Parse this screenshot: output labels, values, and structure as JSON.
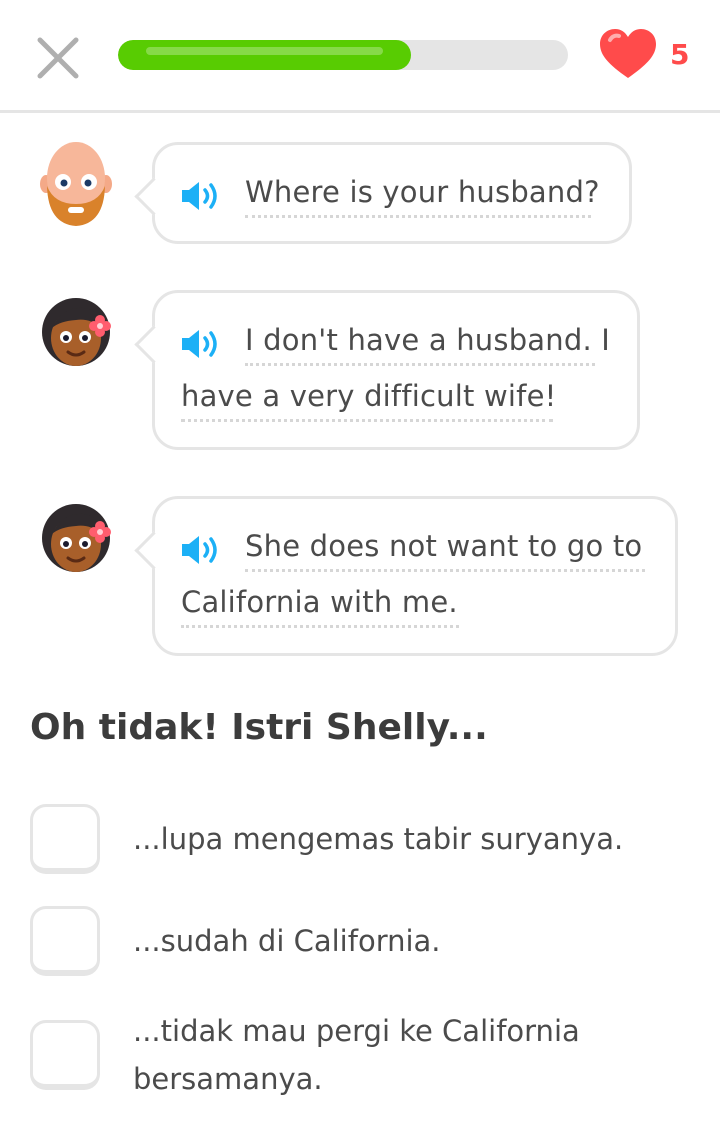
{
  "header": {
    "close_icon": "close-x-icon",
    "progress_percent": 65,
    "progress_color": "#58cc02",
    "hearts_icon": "heart-icon",
    "hearts_count": "5",
    "hearts_color": "#ff4b4b"
  },
  "dialogue": [
    {
      "speaker": "bald-bearded-man-avatar",
      "lines": [
        "Where is your husband?"
      ]
    },
    {
      "speaker": "woman-with-flower-avatar",
      "lines": [
        "I don't have a husband. I",
        "have a very difficult wife!"
      ]
    },
    {
      "speaker": "woman-with-flower-avatar",
      "lines": [
        "She does not want to go to",
        "California with me."
      ]
    }
  ],
  "question": "Oh tidak! Istri Shelly...",
  "options": [
    {
      "lines": [
        "...lupa mengemas tabir suryanya."
      ],
      "checked": false
    },
    {
      "lines": [
        "...sudah di California."
      ],
      "checked": false
    },
    {
      "lines": [
        "...tidak mau pergi ke California",
        "bersamanya."
      ],
      "checked": false
    }
  ],
  "colors": {
    "speaker_blue": "#1cb0f6",
    "border_gray": "#e5e5e5",
    "text": "#4b4b4b"
  }
}
